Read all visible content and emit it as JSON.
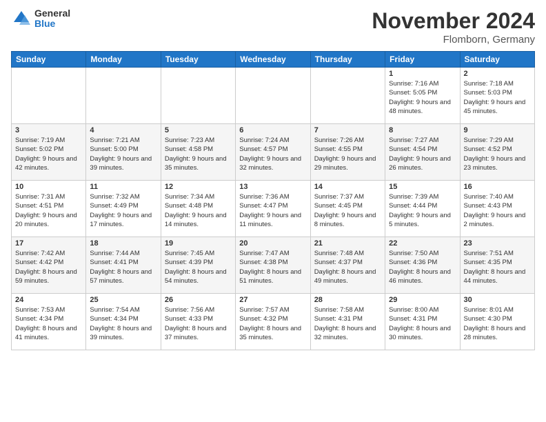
{
  "logo": {
    "general": "General",
    "blue": "Blue"
  },
  "header": {
    "month": "November 2024",
    "location": "Flomborn, Germany"
  },
  "days_of_week": [
    "Sunday",
    "Monday",
    "Tuesday",
    "Wednesday",
    "Thursday",
    "Friday",
    "Saturday"
  ],
  "weeks": [
    [
      {
        "day": "",
        "info": ""
      },
      {
        "day": "",
        "info": ""
      },
      {
        "day": "",
        "info": ""
      },
      {
        "day": "",
        "info": ""
      },
      {
        "day": "",
        "info": ""
      },
      {
        "day": "1",
        "info": "Sunrise: 7:16 AM\nSunset: 5:05 PM\nDaylight: 9 hours and 48 minutes."
      },
      {
        "day": "2",
        "info": "Sunrise: 7:18 AM\nSunset: 5:03 PM\nDaylight: 9 hours and 45 minutes."
      }
    ],
    [
      {
        "day": "3",
        "info": "Sunrise: 7:19 AM\nSunset: 5:02 PM\nDaylight: 9 hours and 42 minutes."
      },
      {
        "day": "4",
        "info": "Sunrise: 7:21 AM\nSunset: 5:00 PM\nDaylight: 9 hours and 39 minutes."
      },
      {
        "day": "5",
        "info": "Sunrise: 7:23 AM\nSunset: 4:58 PM\nDaylight: 9 hours and 35 minutes."
      },
      {
        "day": "6",
        "info": "Sunrise: 7:24 AM\nSunset: 4:57 PM\nDaylight: 9 hours and 32 minutes."
      },
      {
        "day": "7",
        "info": "Sunrise: 7:26 AM\nSunset: 4:55 PM\nDaylight: 9 hours and 29 minutes."
      },
      {
        "day": "8",
        "info": "Sunrise: 7:27 AM\nSunset: 4:54 PM\nDaylight: 9 hours and 26 minutes."
      },
      {
        "day": "9",
        "info": "Sunrise: 7:29 AM\nSunset: 4:52 PM\nDaylight: 9 hours and 23 minutes."
      }
    ],
    [
      {
        "day": "10",
        "info": "Sunrise: 7:31 AM\nSunset: 4:51 PM\nDaylight: 9 hours and 20 minutes."
      },
      {
        "day": "11",
        "info": "Sunrise: 7:32 AM\nSunset: 4:49 PM\nDaylight: 9 hours and 17 minutes."
      },
      {
        "day": "12",
        "info": "Sunrise: 7:34 AM\nSunset: 4:48 PM\nDaylight: 9 hours and 14 minutes."
      },
      {
        "day": "13",
        "info": "Sunrise: 7:36 AM\nSunset: 4:47 PM\nDaylight: 9 hours and 11 minutes."
      },
      {
        "day": "14",
        "info": "Sunrise: 7:37 AM\nSunset: 4:45 PM\nDaylight: 9 hours and 8 minutes."
      },
      {
        "day": "15",
        "info": "Sunrise: 7:39 AM\nSunset: 4:44 PM\nDaylight: 9 hours and 5 minutes."
      },
      {
        "day": "16",
        "info": "Sunrise: 7:40 AM\nSunset: 4:43 PM\nDaylight: 9 hours and 2 minutes."
      }
    ],
    [
      {
        "day": "17",
        "info": "Sunrise: 7:42 AM\nSunset: 4:42 PM\nDaylight: 8 hours and 59 minutes."
      },
      {
        "day": "18",
        "info": "Sunrise: 7:44 AM\nSunset: 4:41 PM\nDaylight: 8 hours and 57 minutes."
      },
      {
        "day": "19",
        "info": "Sunrise: 7:45 AM\nSunset: 4:39 PM\nDaylight: 8 hours and 54 minutes."
      },
      {
        "day": "20",
        "info": "Sunrise: 7:47 AM\nSunset: 4:38 PM\nDaylight: 8 hours and 51 minutes."
      },
      {
        "day": "21",
        "info": "Sunrise: 7:48 AM\nSunset: 4:37 PM\nDaylight: 8 hours and 49 minutes."
      },
      {
        "day": "22",
        "info": "Sunrise: 7:50 AM\nSunset: 4:36 PM\nDaylight: 8 hours and 46 minutes."
      },
      {
        "day": "23",
        "info": "Sunrise: 7:51 AM\nSunset: 4:35 PM\nDaylight: 8 hours and 44 minutes."
      }
    ],
    [
      {
        "day": "24",
        "info": "Sunrise: 7:53 AM\nSunset: 4:34 PM\nDaylight: 8 hours and 41 minutes."
      },
      {
        "day": "25",
        "info": "Sunrise: 7:54 AM\nSunset: 4:34 PM\nDaylight: 8 hours and 39 minutes."
      },
      {
        "day": "26",
        "info": "Sunrise: 7:56 AM\nSunset: 4:33 PM\nDaylight: 8 hours and 37 minutes."
      },
      {
        "day": "27",
        "info": "Sunrise: 7:57 AM\nSunset: 4:32 PM\nDaylight: 8 hours and 35 minutes."
      },
      {
        "day": "28",
        "info": "Sunrise: 7:58 AM\nSunset: 4:31 PM\nDaylight: 8 hours and 32 minutes."
      },
      {
        "day": "29",
        "info": "Sunrise: 8:00 AM\nSunset: 4:31 PM\nDaylight: 8 hours and 30 minutes."
      },
      {
        "day": "30",
        "info": "Sunrise: 8:01 AM\nSunset: 4:30 PM\nDaylight: 8 hours and 28 minutes."
      }
    ]
  ]
}
